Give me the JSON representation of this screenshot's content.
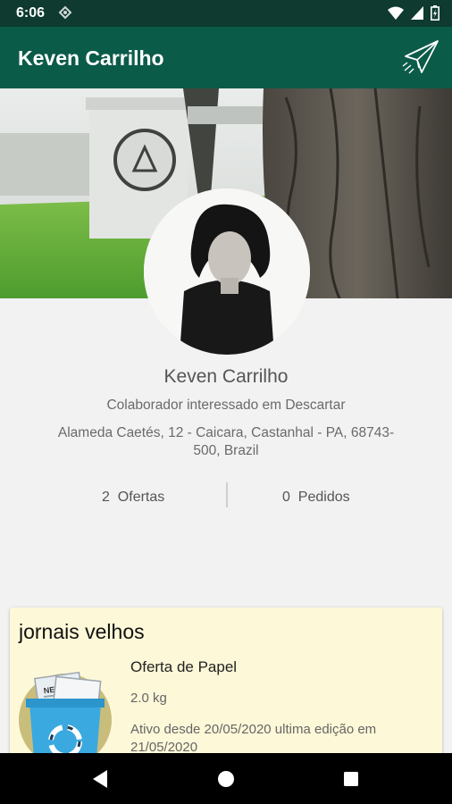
{
  "status_bar": {
    "time": "6:06"
  },
  "app_bar": {
    "title": "Keven Carrilho"
  },
  "profile": {
    "name": "Keven Carrilho",
    "role": "Colaborador interessado em Descartar",
    "address": "Alameda Caetés, 12 - Caicara, Castanhal - PA, 68743-500, Brazil"
  },
  "stats": {
    "offers": {
      "count": "2",
      "label": "Ofertas"
    },
    "orders": {
      "count": "0",
      "label": "Pedidos"
    }
  },
  "offer_card": {
    "title": "jornais velhos",
    "type": "Oferta de Papel",
    "weight": "2.0 kg",
    "dates": "Ativo desde 20/05/2020 ultima edição em 21/05/2020"
  },
  "icons": {
    "send": "paper-plane-icon",
    "wifi": "wifi-icon",
    "signal": "signal-icon",
    "battery": "battery-icon",
    "back": "back-icon",
    "home": "home-icon",
    "recents": "recents-icon"
  },
  "colors": {
    "status_bar": "#0e3a30",
    "app_bar": "#0b5b49",
    "card_background": "#fdf8d8",
    "background": "#f2f2f2"
  }
}
